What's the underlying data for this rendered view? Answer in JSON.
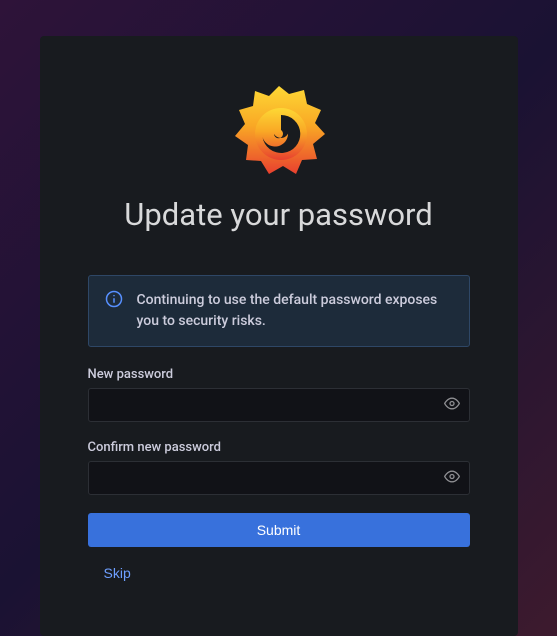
{
  "page": {
    "title": "Update your password"
  },
  "alert": {
    "message": "Continuing to use the default password exposes you to security risks."
  },
  "form": {
    "new_password": {
      "label": "New password",
      "value": ""
    },
    "confirm_password": {
      "label": "Confirm new password",
      "value": ""
    },
    "submit_label": "Submit",
    "skip_label": "Skip"
  },
  "icons": {
    "logo": "grafana-logo-icon",
    "info": "info-icon",
    "eye": "eye-icon"
  },
  "colors": {
    "card_bg": "#181b1f",
    "primary": "#3871dc",
    "link": "#6e9fff",
    "text": "#ccccdc",
    "alert_bg": "#1d2b3a",
    "alert_border": "#2e4766",
    "info_icon": "#5790ff",
    "logo_gradient_top": "#fdd835",
    "logo_gradient_bottom": "#f05a28"
  }
}
